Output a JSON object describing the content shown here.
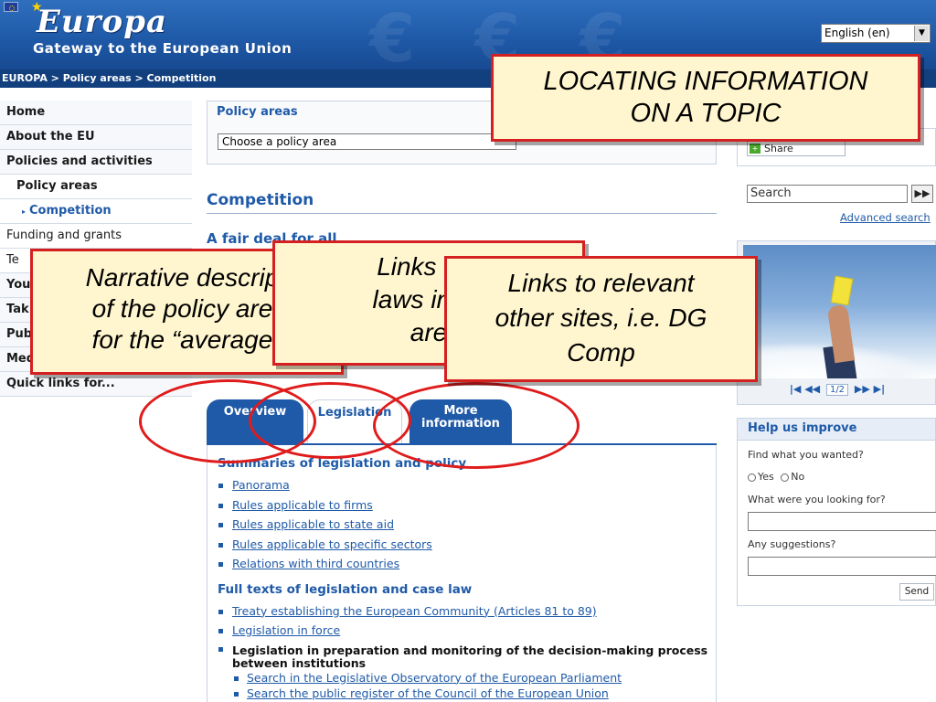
{
  "header": {
    "logo_text": "Europa",
    "tagline": "Gateway to the European Union",
    "language_select": "English (en)"
  },
  "breadcrumb": "EUROPA > Policy areas > Competition",
  "left_nav": {
    "home": "Home",
    "about": "About the EU",
    "policies": "Policies and activities",
    "policy_areas": "Policy areas",
    "competition": "Competition",
    "funding": "Funding and grants",
    "te": "Te",
    "you": "You",
    "tak": "Tak",
    "pub": "Pub",
    "med": "Med",
    "quick_links": "Quick links for..."
  },
  "policy_box": {
    "title": "Policy areas",
    "select_value": "Choose a policy area"
  },
  "main": {
    "section_title": "Competition",
    "subtitle": "A fair deal for all"
  },
  "tabs": {
    "overview": "Overview",
    "legislation": "Legislation",
    "more_line1": "More",
    "more_line2": "information"
  },
  "content": {
    "heading1": "Summaries of legislation and policy",
    "summaries": [
      "Panorama",
      "Rules applicable to firms",
      "Rules applicable to state aid",
      "Rules applicable to specific sectors",
      "Relations with third countries"
    ],
    "heading2": "Full texts of legislation and case law",
    "full_texts": [
      "Treaty establishing the European Community (Articles 81 to 89)",
      "Legislation in force"
    ],
    "bold_item": "Legislation in preparation and monitoring of the decision-making process between institutions",
    "nested_items": [
      "Search in the Legislative Observatory of the European Parliament",
      "Search the public register of the Council of the European Union"
    ]
  },
  "right": {
    "share_label": "Share",
    "search_placeholder": "Search",
    "search_go": "▶▶",
    "advanced_search": "Advanced search",
    "slider_page": "1/2",
    "help": {
      "title": "Help us improve",
      "q1": "Find what you wanted?",
      "yes": "Yes",
      "no": "No",
      "q2": "What were you looking for?",
      "q3": "Any suggestions?",
      "send": "Send"
    }
  },
  "annotations": {
    "title_line1": "LOCATING INFORMATION",
    "title_line2": "ON A TOPIC",
    "narrative_line1": "Narrative descrip",
    "narrative_line2": "of the policy are",
    "narrative_line3": "for the “average",
    "laws_line1": "Links to r",
    "laws_line2": "laws in thi",
    "laws_line3": "are",
    "other_line1": "Links to relevant",
    "other_line2": "other sites, i.e. DG",
    "other_line3": "Comp"
  },
  "colors": {
    "brand_blue": "#1f5aa8",
    "header_blue": "#2f6fbe",
    "callout_fill": "#fff6cf",
    "callout_border": "#d42020"
  }
}
